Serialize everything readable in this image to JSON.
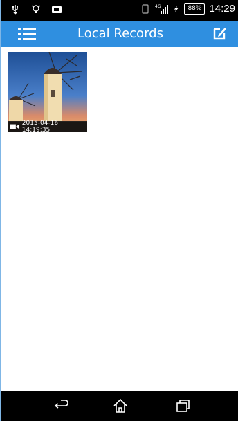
{
  "status_bar": {
    "battery_percent": "88%",
    "network": "4G",
    "time": "14:29"
  },
  "app_bar": {
    "title": "Local Records",
    "menu_icon": "menu-icon",
    "edit_icon": "edit-icon"
  },
  "records": [
    {
      "type": "video",
      "timestamp": "2015-04-16 14:19:35"
    }
  ],
  "nav_bar": {
    "back_icon": "back-icon",
    "home_icon": "home-icon",
    "recent_icon": "recent-apps-icon"
  },
  "colors": {
    "app_bar": "#2f8fe0",
    "frame_border": "#7fb6e6",
    "status_bar": "#000000",
    "nav_bar": "#000000"
  }
}
